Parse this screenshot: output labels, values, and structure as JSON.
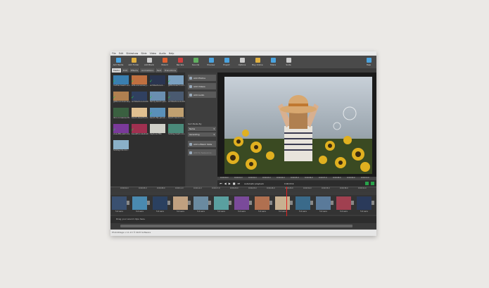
{
  "menu": [
    "File",
    "Edit",
    "Slideshow",
    "Slide",
    "Video",
    "Audio",
    "Help"
  ],
  "toolbar": [
    {
      "label": "Add Media",
      "color": "#4aa3df"
    },
    {
      "label": "Add Folder",
      "color": "#e0b040"
    },
    {
      "label": "Add Blank",
      "color": "#cccccc"
    },
    {
      "label": "Wizard",
      "color": "#e06030"
    },
    {
      "label": "Narrate",
      "color": "#d04040"
    },
    {
      "label": "Sounds",
      "color": "#60b060"
    },
    {
      "label": "Preview",
      "color": "#4aa3df"
    },
    {
      "label": "Export",
      "color": "#4aa3df"
    },
    {
      "label": "Options",
      "color": "#cccccc"
    },
    {
      "label": "Buy Online",
      "color": "#e0b040"
    },
    {
      "label": "Share",
      "color": "#4aa3df"
    },
    {
      "label": "Suite",
      "color": "#cccccc"
    },
    {
      "label": "Help",
      "color": "#4aa3df"
    }
  ],
  "tabs": [
    "Media",
    "Edit",
    "Effects",
    "Animations",
    "Text",
    "Transitions"
  ],
  "media_items": [
    {
      "caption": "mother-beach-sun...",
      "color": "#3a7fb0",
      "checked": true
    },
    {
      "caption": "wife-anniversary...",
      "color": "#c07040",
      "checked": true
    },
    {
      "caption": "architecture-b...",
      "color": "#2a3550",
      "checked": true
    },
    {
      "caption": "glitter-beach-sum...",
      "color": "#7aa0c0",
      "checked": true
    },
    {
      "caption": "glitter-anniversary...",
      "color": "#b08050",
      "checked": true
    },
    {
      "caption": "architecture-buildi...",
      "color": "#304060",
      "checked": true
    },
    {
      "caption": "family-beach-peo...",
      "color": "#6a8fb0",
      "checked": true
    },
    {
      "caption": "architecture-buildi...",
      "color": "#4a5a70",
      "checked": true
    },
    {
      "caption": "dino-nonsense-tit...",
      "color": "#3a6040",
      "checked": false
    },
    {
      "caption": "beach-beautiful-b...",
      "color": "#e0c090",
      "checked": false
    },
    {
      "caption": "beach-flip-jali-sli...",
      "color": "#5a90b8",
      "checked": true
    },
    {
      "caption": "beach-hand-in-sa...",
      "color": "#c0a070",
      "checked": false
    },
    {
      "caption": "view-MQ-palm-tre...",
      "color": "#7a3a9a",
      "checked": true
    },
    {
      "caption": "beautiful-celebrati...",
      "color": "#a03050",
      "checked": true
    },
    {
      "caption": "Capture.PNG",
      "color": "#d0d0c8",
      "checked": false
    },
    {
      "caption": "holiday-heart-coo...",
      "color": "#4a8a7a",
      "checked": true
    },
    {
      "caption": "holiday-iris-coo...",
      "color": "#8ab0c8",
      "checked": false
    }
  ],
  "actions": {
    "add_photos": "Add Photos",
    "add_videos": "Add Videos",
    "add_audio": "Add Audio",
    "sort_label": "Sort Media By",
    "sort_by": "Name",
    "sort_order": "Ascending",
    "add_blank_slide": "Add a Blank Slide",
    "add_to_sequence": "Add to Sequence"
  },
  "preview": {
    "ruler_ticks": [
      "0:00:00.0",
      "0:00:01.0",
      "0:00:02.0",
      "0:00:03.0",
      "0:00:04.0",
      "0:00:05.0",
      "0:00:06.0",
      "0:00:07.0",
      "0:00:08.0",
      "0:00:09.0",
      "0:00:10.0"
    ],
    "auto_label": "Automatic playback",
    "time": "0:00:03.6"
  },
  "timeline": {
    "ticks": [
      "0:00:02.0",
      "0:00:05.0",
      "0:00:08.0",
      "0:00:11.0",
      "0:00:14.0",
      "0:00:17.0",
      "0:00:20.0",
      "0:00:23.0",
      "0:00:26.0",
      "0:00:29.0",
      "0:00:32.0",
      "0:00:35.0",
      "0:00:38.0",
      "0:00:41.0"
    ],
    "clips": [
      {
        "duration": "5.0 secs",
        "color": "#3a5070"
      },
      {
        "duration": "5.0 secs",
        "color": "#4a8ab0"
      },
      {
        "duration": "5.0 secs",
        "color": "#2a4060"
      },
      {
        "duration": "5.0 secs",
        "color": "#c0a080"
      },
      {
        "duration": "5.0 secs",
        "color": "#6a8aa0"
      },
      {
        "duration": "5.0 secs",
        "color": "#5aa0a0"
      },
      {
        "duration": "5.0 secs",
        "color": "#7a4a9a"
      },
      {
        "duration": "5.0 secs",
        "color": "#b07050"
      },
      {
        "duration": "5.0 secs",
        "color": "#c8b090"
      },
      {
        "duration": "5.0 secs",
        "color": "#3a6a8a"
      },
      {
        "duration": "5.0 secs",
        "color": "#5a7a9a"
      },
      {
        "duration": "5.0 secs",
        "color": "#a04050"
      },
      {
        "duration": "5.0 secs",
        "color": "#2a3a5a"
      }
    ],
    "audio_hint": "Drag your sound clips here."
  },
  "status": "PhotoStage v 11.13 © NCH Software"
}
